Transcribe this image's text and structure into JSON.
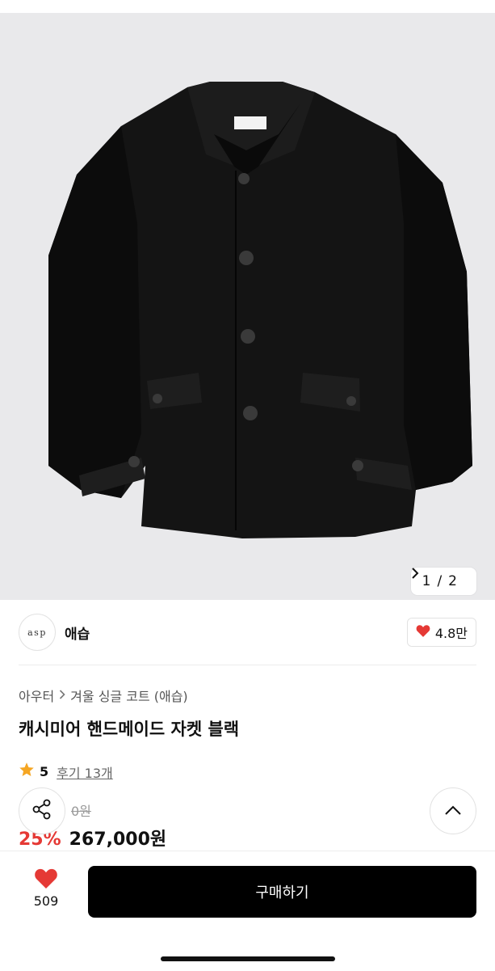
{
  "hero": {
    "counter": {
      "current": "1",
      "separator": "/",
      "total": "2",
      "next_icon": "chevron-right-icon"
    },
    "image_alt_icon": "jacket-image"
  },
  "store": {
    "logo_text": "asp",
    "name": "애습",
    "likes": "4.8만",
    "like_icon": "heart-icon",
    "heart_color": "#e53935"
  },
  "product": {
    "breadcrumb": [
      "아우터",
      "겨울 싱글 코트 (애습)"
    ],
    "title": "캐시미어 핸드메이드 자켓 블랙",
    "rating": "5",
    "reviews": "후기 13개",
    "original_price": "0원",
    "discount": "25%",
    "price": "267,000원",
    "discount_color": "#e53935"
  },
  "floating": {
    "share_icon": "share-icon",
    "scroll_top_icon": "chevron-up-icon"
  },
  "bottom_bar": {
    "wish_count": "509",
    "buy_label": "구매하기",
    "buy_bg": "#000000"
  }
}
